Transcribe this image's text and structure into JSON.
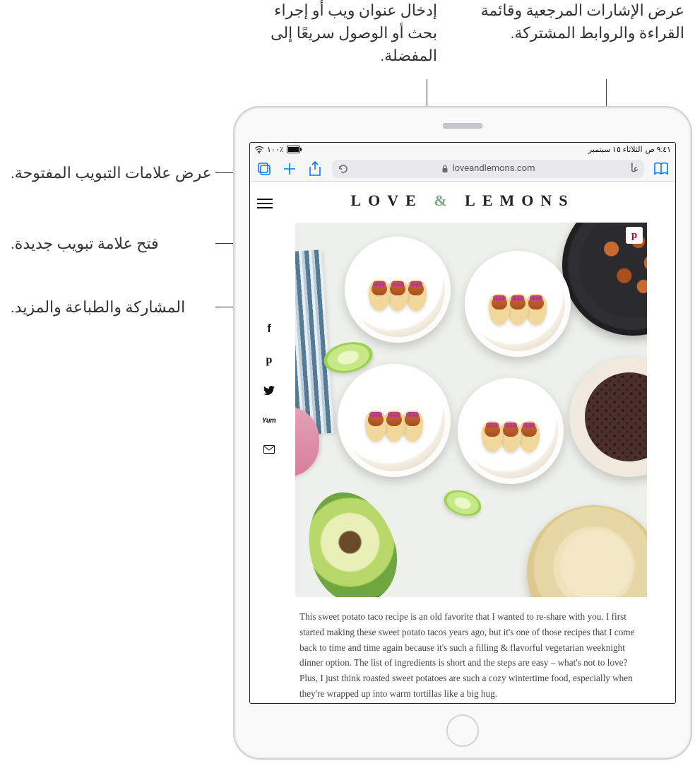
{
  "callouts": {
    "bookmarks": "عرض الإشارات المرجعية وقائمة القراءة والروابط المشتركة.",
    "search": "إدخال عنوان ويب أو إجراء بحث أو الوصول سريعًا إلى المفضلة.",
    "tabs": "عرض علامات التبويب المفتوحة.",
    "newtab": "فتح علامة تبويب جديدة.",
    "share": "المشاركة والطباعة والمزيد."
  },
  "status": {
    "time": "٩:٤١ ص",
    "date": "الثلاثاء ١٥ سبتمبر",
    "battery_pct": "٪١٠٠"
  },
  "toolbar": {
    "url_display": "loveandlemons.com",
    "reader_toggle": "عأ"
  },
  "site": {
    "title_pre": "LOVE",
    "title_amp": "&",
    "title_post": "LEMONS"
  },
  "social": {
    "facebook": "f",
    "pinterest": "p",
    "twitter": "t",
    "yum": "Yum",
    "mail": "✉"
  },
  "article": {
    "pinterest_icon": "p",
    "body": "This sweet potato taco recipe is an old favorite that I wanted to re-share with you. I first started making these sweet potato tacos years ago, but it's one of those recipes that I come back to time and time again because it's such a filling & flavorful vegetarian weeknight dinner option. The list of ingredients is short and the steps are easy – what's not to love? Plus, I just think roasted sweet potatoes are such a cozy wintertime food, especially when they're wrapped up into warm tortillas like a big hug."
  }
}
